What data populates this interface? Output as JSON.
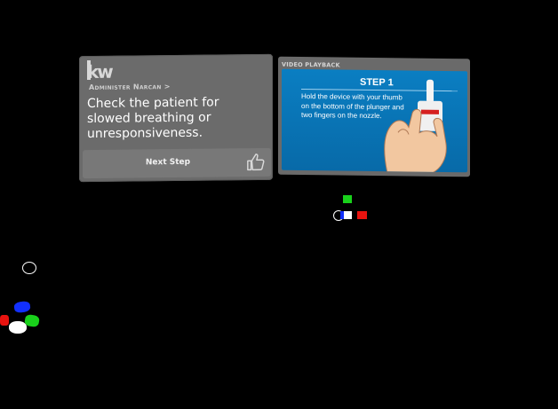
{
  "instruction_panel": {
    "logo_text": "kw",
    "breadcrumb": "Administer Narcan >",
    "instruction": "Check the patient for slowed breathing or unresponsiveness.",
    "next_step_label": "Next Step",
    "like_icon": "thumbs-up-icon"
  },
  "video_panel": {
    "title": "VIDEO PLAYBACK",
    "step_title": "STEP 1",
    "step_text": "Hold the device with your thumb on the bottom of the plunger and two fingers on the nozzle."
  },
  "markers": {
    "colors": {
      "green": "#19d11b",
      "blue": "#1230ff",
      "red": "#e8130f",
      "white": "#ffffff"
    }
  }
}
